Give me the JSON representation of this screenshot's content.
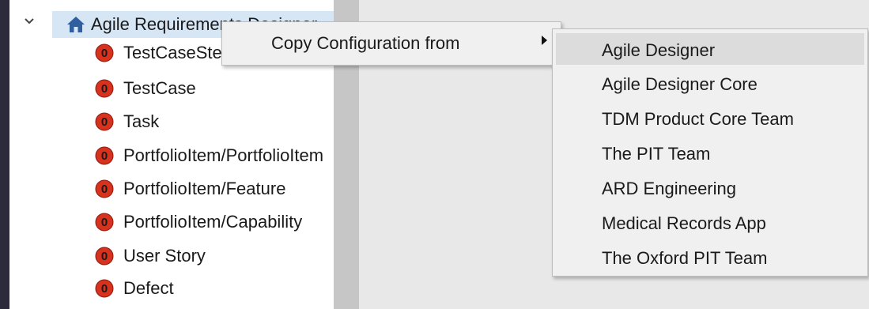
{
  "tree": {
    "root_label": "Agile Requirements Designer",
    "items": [
      {
        "label": "TestCaseStep",
        "badge": "0"
      },
      {
        "label": "TestCase",
        "badge": "0"
      },
      {
        "label": "Task",
        "badge": "0"
      },
      {
        "label": "PortfolioItem/PortfolioItem",
        "badge": "0"
      },
      {
        "label": "PortfolioItem/Feature",
        "badge": "0"
      },
      {
        "label": "PortfolioItem/Capability",
        "badge": "0"
      },
      {
        "label": "User Story",
        "badge": "0"
      },
      {
        "label": "Defect",
        "badge": "0"
      }
    ],
    "icons": {
      "root": "home-icon",
      "expander": "chevron-down-icon",
      "item": "error-badge-icon"
    }
  },
  "context_menu": {
    "items": [
      {
        "label": "Copy Configuration from",
        "has_submenu": true
      }
    ]
  },
  "submenu": {
    "selected_index": 0,
    "items": [
      {
        "label": "Agile Designer"
      },
      {
        "label": "Agile Designer Core"
      },
      {
        "label": "TDM Product Core Team"
      },
      {
        "label": "The PIT Team"
      },
      {
        "label": "ARD Engineering"
      },
      {
        "label": "Medical Records App"
      },
      {
        "label": "The Oxford PIT Team"
      }
    ]
  },
  "colors": {
    "background": "#2b2b3c",
    "badge_red": "#d6321e",
    "home_blue": "#2f5f9e",
    "selection": "#d7e6f5",
    "menu_background": "#f0f0f0",
    "menu_hover": "#dcdcdc"
  }
}
